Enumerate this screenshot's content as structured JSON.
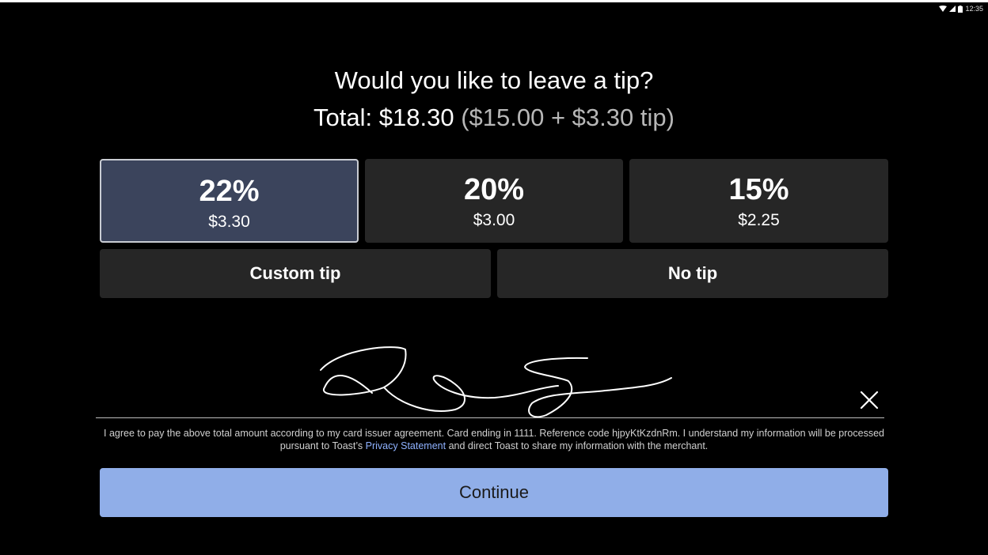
{
  "status_bar": {
    "time": "12:35",
    "icons": [
      "wifi-icon",
      "cellular-signal-icon",
      "battery-icon"
    ]
  },
  "header": {
    "title": "Would you like to leave a tip?",
    "total_label": "Total: $18.30",
    "total_breakdown": "($15.00 + $3.30 tip)"
  },
  "tip_options": [
    {
      "percent": "22%",
      "amount": "$3.30",
      "selected": true
    },
    {
      "percent": "20%",
      "amount": "$3.00",
      "selected": false
    },
    {
      "percent": "15%",
      "amount": "$2.25",
      "selected": false
    }
  ],
  "buttons": {
    "custom_tip": "Custom tip",
    "no_tip": "No tip",
    "continue": "Continue"
  },
  "signature": {
    "clear_icon": "close-icon"
  },
  "agreement": {
    "text_before": "I agree to pay the above total amount according to my card issuer agreement. Card ending in 1111. Reference code hjpyKtKzdnRm. I understand my information will be processed pursuant to Toast’s",
    "link_text": "Privacy Statement",
    "text_after": "and direct Toast to share my information with the merchant."
  },
  "colors": {
    "background": "#000000",
    "option_background": "#262626",
    "selected_option_background": "#3b445c",
    "continue_background": "#90aee8",
    "link": "#8fb2ff"
  }
}
